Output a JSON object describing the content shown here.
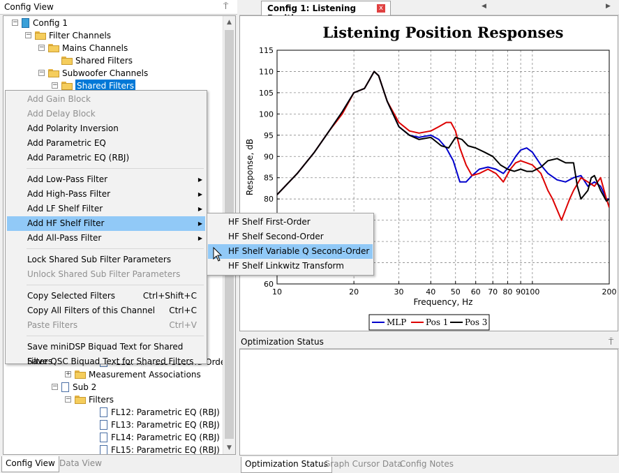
{
  "left_pane": {
    "title": "Config View",
    "pin_glyph": "⍑",
    "tree": [
      {
        "label": "Config 1",
        "icon": "config-doc-icon",
        "expander": "-"
      },
      {
        "label": "Filter Channels",
        "icon": "folder-icon",
        "expander": "-"
      },
      {
        "label": "Mains Channels",
        "icon": "folder-icon",
        "expander": "-"
      },
      {
        "label": "Shared Filters",
        "icon": "folder-icon",
        "expander": ""
      },
      {
        "label": "Subwoofer Channels",
        "icon": "folder-icon",
        "expander": "-"
      },
      {
        "label": "Shared Filters",
        "icon": "folder-icon",
        "expander": "-",
        "selected": true
      },
      {
        "label": "FL11: All-Pass Second-Order",
        "icon": "doc-icon",
        "expander": ""
      },
      {
        "label": "Measurement Associations",
        "icon": "folder-icon",
        "expander": "+"
      },
      {
        "label": "Sub 2",
        "icon": "doc-icon",
        "expander": "-"
      },
      {
        "label": "Filters",
        "icon": "folder-icon",
        "expander": "-"
      },
      {
        "label": "FL12: Parametric EQ (RBJ)",
        "icon": "doc-icon",
        "expander": ""
      },
      {
        "label": "FL13: Parametric EQ (RBJ)",
        "icon": "doc-icon",
        "expander": ""
      },
      {
        "label": "FL14: Parametric EQ (RBJ)",
        "icon": "doc-icon",
        "expander": ""
      },
      {
        "label": "FL15: Parametric EQ (RBJ)",
        "icon": "doc-icon",
        "expander": ""
      }
    ],
    "bottom_tabs": [
      "Config View",
      "Data View"
    ]
  },
  "context_menu": {
    "items": [
      {
        "label": "Add Gain Block",
        "disabled": true
      },
      {
        "label": "Add Delay Block",
        "disabled": true
      },
      {
        "label": "Add Polarity Inversion"
      },
      {
        "label": "Add Parametric EQ"
      },
      {
        "label": "Add Parametric EQ (RBJ)"
      },
      {
        "separator": true
      },
      {
        "label": "Add Low-Pass Filter",
        "submenu": true
      },
      {
        "label": "Add High-Pass Filter",
        "submenu": true
      },
      {
        "label": "Add LF Shelf Filter",
        "submenu": true
      },
      {
        "label": "Add HF Shelf Filter",
        "submenu": true,
        "highlighted": true
      },
      {
        "label": "Add All-Pass Filter",
        "submenu": true
      },
      {
        "separator": true
      },
      {
        "label": "Lock Shared Sub Filter Parameters"
      },
      {
        "label": "Unlock Shared Sub Filter Parameters",
        "disabled": true
      },
      {
        "separator": true
      },
      {
        "label": "Copy Selected Filters",
        "shortcut": "Ctrl+Shift+C"
      },
      {
        "label": "Copy All Filters of this Channel",
        "shortcut": "Ctrl+C"
      },
      {
        "label": "Paste Filters",
        "shortcut": "Ctrl+V",
        "disabled": true
      },
      {
        "separator": true
      },
      {
        "label": "Save miniDSP Biquad Text for Shared Filters"
      },
      {
        "label": "Save QSC Biquad Text for Shared Filters"
      }
    ],
    "submenu": [
      {
        "label": "HF Shelf First-Order"
      },
      {
        "label": "HF Shelf Second-Order"
      },
      {
        "label": "HF Shelf Variable Q Second-Order",
        "highlighted": true
      },
      {
        "label": "HF Shelf Linkwitz Transform"
      }
    ]
  },
  "document_tab": {
    "label": "Config 1: Listening Positions",
    "close_glyph": "x"
  },
  "chart_data": {
    "type": "line",
    "title": "Listening Position Responses",
    "xlabel": "Frequency, Hz",
    "ylabel": "Response, dB",
    "x_scale": "log",
    "xlim": [
      10,
      200
    ],
    "ylim": [
      60,
      115
    ],
    "x_ticks": [
      10,
      20,
      30,
      40,
      50,
      60,
      70,
      80,
      90,
      100,
      200
    ],
    "y_ticks": [
      60,
      65,
      70,
      75,
      80,
      85,
      90,
      95,
      100,
      105,
      110,
      115
    ],
    "grid": true,
    "legend_position": "bottom-center",
    "series": [
      {
        "name": "MLP",
        "color": "#0000cc",
        "x": [
          10,
          12,
          14,
          16,
          18,
          20,
          22,
          23,
          24,
          25,
          27,
          30,
          33,
          36,
          40,
          43,
          46,
          49,
          52,
          55,
          58,
          62,
          67,
          72,
          77,
          82,
          86,
          90,
          95,
          100,
          108,
          115,
          125,
          135,
          145,
          155,
          165,
          175,
          185,
          195,
          200
        ],
        "y": [
          81,
          86,
          91,
          96,
          100.5,
          105,
          106,
          108,
          110,
          109,
          103,
          97,
          95,
          94.5,
          95,
          94,
          92,
          89,
          84,
          84,
          85.5,
          87,
          87.5,
          87,
          86,
          88,
          90,
          91.5,
          92,
          91,
          88,
          86,
          84.5,
          84,
          85,
          85.5,
          83,
          84,
          83,
          80,
          80
        ]
      },
      {
        "name": "Pos 1",
        "color": "#dd0000",
        "x": [
          10,
          12,
          14,
          16,
          18,
          20,
          22,
          23,
          24,
          25,
          27,
          30,
          33,
          36,
          40,
          43,
          46,
          48,
          50,
          52,
          55,
          58,
          62,
          67,
          72,
          77,
          82,
          86,
          90,
          95,
          100,
          108,
          115,
          120,
          130,
          140,
          145,
          155,
          165,
          175,
          185,
          195,
          200
        ],
        "y": [
          81,
          86,
          91,
          96,
          100,
          105,
          106,
          108,
          110,
          109,
          103,
          98,
          96,
          95.5,
          96,
          97,
          98,
          98,
          96,
          92,
          88,
          85.5,
          86,
          87,
          86,
          84,
          87,
          88.5,
          89,
          88.5,
          88,
          86,
          82,
          80,
          75,
          80,
          82,
          85,
          84,
          83,
          85,
          80,
          78
        ]
      },
      {
        "name": "Pos 3",
        "color": "#000000",
        "x": [
          10,
          12,
          14,
          16,
          18,
          20,
          22,
          23,
          24,
          25,
          27,
          30,
          33,
          36,
          40,
          44,
          47,
          50,
          53,
          56,
          60,
          65,
          70,
          75,
          80,
          85,
          90,
          95,
          100,
          108,
          115,
          125,
          135,
          145,
          150,
          155,
          165,
          170,
          175,
          185,
          195,
          200
        ],
        "y": [
          81,
          86,
          91,
          96,
          100.5,
          105,
          106,
          108,
          110,
          109,
          103,
          97,
          95,
          94,
          94.5,
          92.5,
          92,
          94.5,
          94,
          92.5,
          92,
          91,
          90,
          88,
          87,
          86.5,
          87,
          86.5,
          86.5,
          87.5,
          89,
          89.5,
          88.5,
          88.5,
          83,
          80,
          82,
          85,
          85.5,
          82,
          79.5,
          80
        ]
      }
    ]
  },
  "optimization_panel": {
    "title": "Optimization Status",
    "pin_glyph": "⍑"
  },
  "right_bottom_tabs": [
    "Optimization Status",
    "Graph Cursor Data",
    "Config Notes"
  ]
}
